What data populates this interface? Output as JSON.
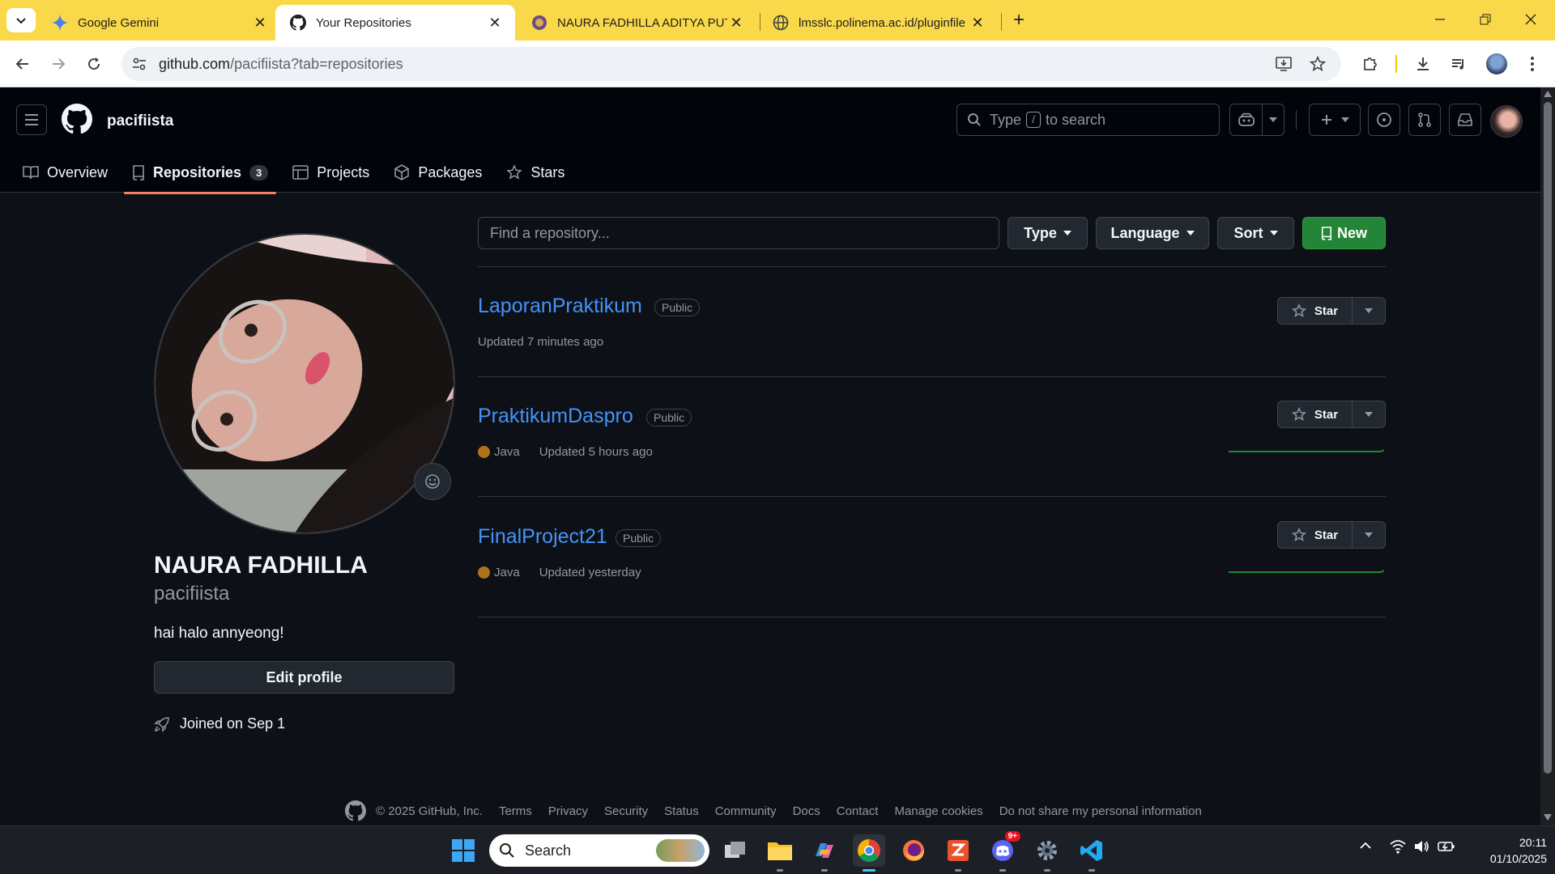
{
  "browser": {
    "tabs": [
      {
        "title": "Google Gemini",
        "icon": "gemini-icon",
        "active": false
      },
      {
        "title": "Your Repositories",
        "icon": "github-icon",
        "active": true
      },
      {
        "title": "NAURA FADHILLA ADITYA PUTF",
        "icon": "polinema-icon",
        "active": false
      },
      {
        "title": "lmsslc.polinema.ac.id/pluginfile",
        "icon": "globe-icon",
        "active": false
      }
    ],
    "url_host": "github.com",
    "url_path": "/pacifiista?tab=repositories"
  },
  "github": {
    "username": "pacifiista",
    "search_placeholder_pre": "Type",
    "search_key": "/",
    "search_placeholder_post": "to search",
    "nav": [
      {
        "label": "Overview",
        "icon": "book-icon"
      },
      {
        "label": "Repositories",
        "icon": "repo-icon",
        "count": "3",
        "active": true
      },
      {
        "label": "Projects",
        "icon": "table-icon"
      },
      {
        "label": "Packages",
        "icon": "package-icon"
      },
      {
        "label": "Stars",
        "icon": "star-icon"
      }
    ]
  },
  "profile": {
    "name": "NAURA FADHILLA",
    "login": "pacifiista",
    "bio": "hai halo annyeong!",
    "edit_label": "Edit profile",
    "joined": "Joined on Sep 1"
  },
  "repos_toolbar": {
    "find_placeholder": "Find a repository...",
    "type_label": "Type",
    "language_label": "Language",
    "sort_label": "Sort",
    "new_label": "New"
  },
  "repos": [
    {
      "name": "LaporanPraktikum",
      "visibility": "Public",
      "language": "",
      "updated": "Updated 7 minutes ago",
      "star_label": "Star"
    },
    {
      "name": "PraktikumDaspro",
      "visibility": "Public",
      "language": "Java",
      "updated": "Updated 5 hours ago",
      "star_label": "Star"
    },
    {
      "name": "FinalProject21",
      "visibility": "Public",
      "language": "Java",
      "updated": "Updated yesterday",
      "star_label": "Star"
    }
  ],
  "colors": {
    "java": "#b07219",
    "accent": "#f78166",
    "link": "#4493f8",
    "new_button": "#238636",
    "tab_strip": "#f9d949"
  },
  "footer": {
    "copyright": "© 2025 GitHub, Inc.",
    "links": [
      "Terms",
      "Privacy",
      "Security",
      "Status",
      "Community",
      "Docs",
      "Contact",
      "Manage cookies",
      "Do not share my personal information"
    ]
  },
  "taskbar": {
    "search_label": "Search",
    "time": "20:11",
    "date": "01/10/2025",
    "discord_badge": "9+"
  }
}
